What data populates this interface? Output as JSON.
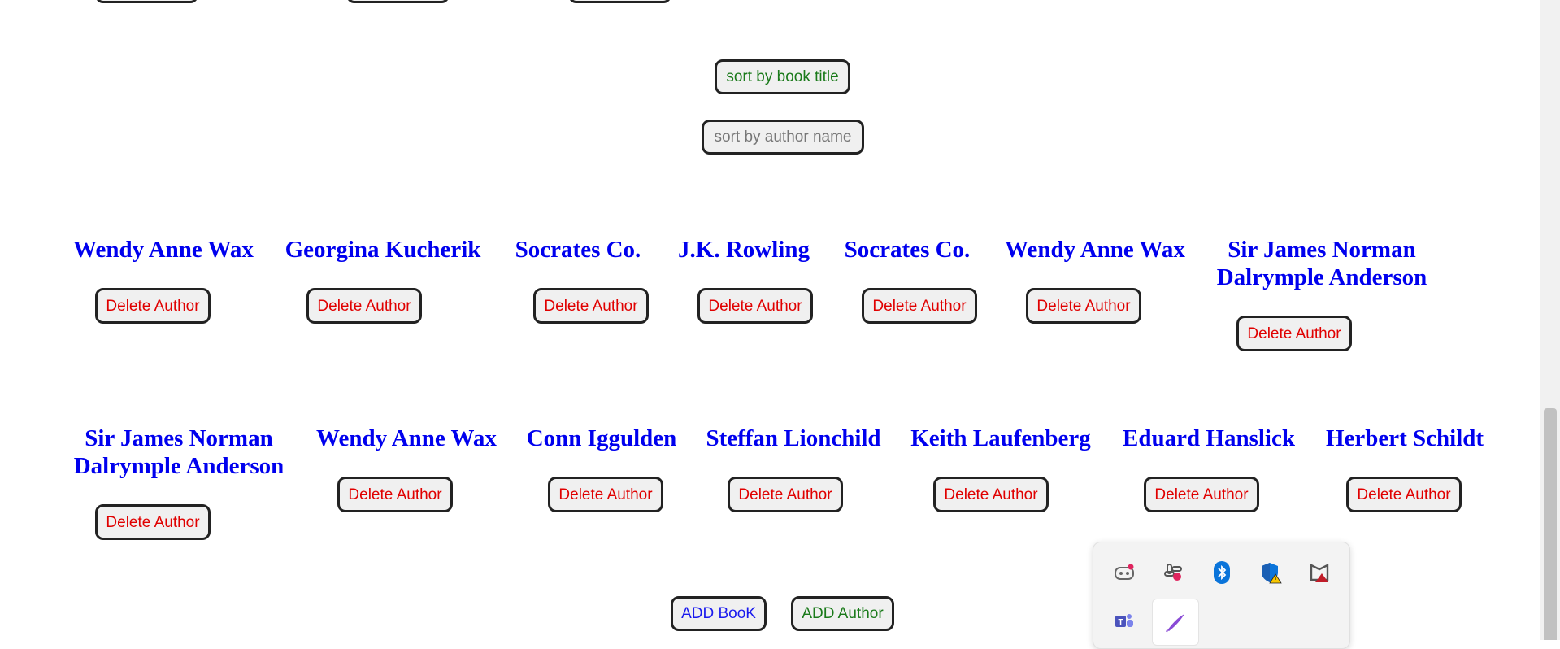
{
  "sort": {
    "by_title": "sort by book title",
    "by_author": "sort by author name"
  },
  "authors_row1": [
    {
      "name": "Wendy Anne Wax",
      "delete": "Delete Author"
    },
    {
      "name": "Georgina Kucherik",
      "delete": "Delete Author"
    },
    {
      "name": "Socrates Co.",
      "delete": "Delete Author"
    },
    {
      "name": "J.K. Rowling",
      "delete": "Delete Author"
    },
    {
      "name": "Socrates Co.",
      "delete": "Delete Author"
    },
    {
      "name": "Wendy Anne Wax",
      "delete": "Delete Author"
    },
    {
      "name": "Sir James Norman Dalrymple Anderson",
      "delete": "Delete Author"
    }
  ],
  "authors_row2": [
    {
      "name": "Sir James Norman Dalrymple Anderson",
      "delete": "Delete Author"
    },
    {
      "name": "Wendy Anne Wax",
      "delete": "Delete Author"
    },
    {
      "name": "Conn Iggulden",
      "delete": "Delete Author"
    },
    {
      "name": "Steffan Lionchild",
      "delete": "Delete Author"
    },
    {
      "name": "Keith Laufenberg",
      "delete": "Delete Author"
    },
    {
      "name": "Eduard Hanslick",
      "delete": "Delete Author"
    },
    {
      "name": "Herbert Schildt",
      "delete": "Delete Author"
    }
  ],
  "actions": {
    "add_book": "ADD BooK",
    "add_author": "ADD Author"
  },
  "colors": {
    "author_name": "#0000ee",
    "delete_text": "#e00000",
    "sort_title_text": "#1a7a1a",
    "sort_author_text": "#777777",
    "add_book_text": "#1a1aee",
    "add_author_text": "#1a7a1a"
  },
  "tray_icons": [
    "copilot-icon",
    "slack-icon",
    "bluetooth-icon",
    "defender-icon",
    "mcafee-icon",
    "teams-icon",
    "pen-icon"
  ]
}
